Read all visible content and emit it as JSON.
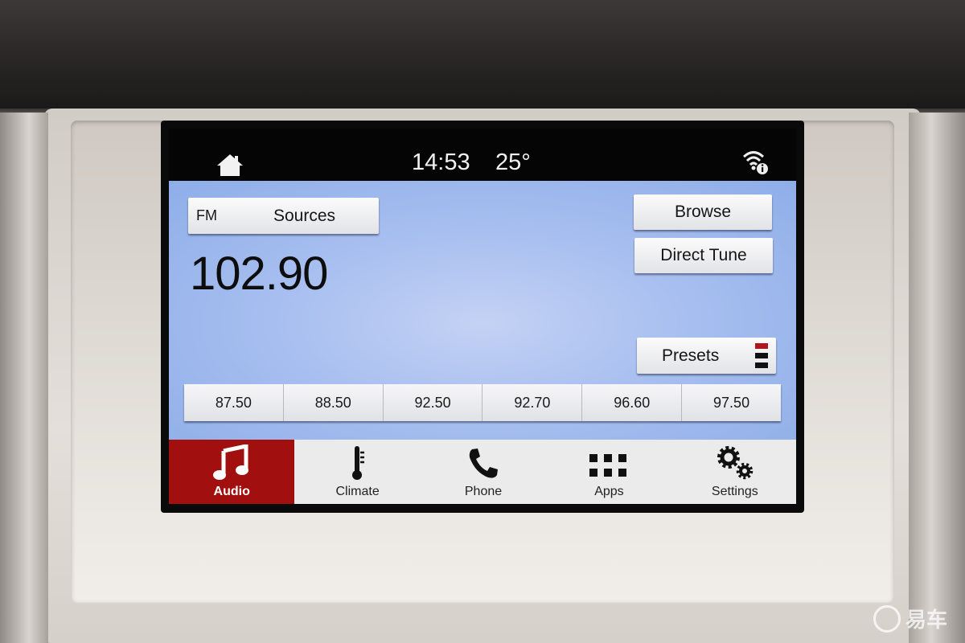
{
  "status_bar": {
    "time": "14:53",
    "temperature": "25°",
    "home_icon": "home-icon",
    "connectivity_icon": "wifi-info-icon"
  },
  "audio": {
    "band": "FM",
    "sources_label": "Sources",
    "frequency": "102.90",
    "browse_label": "Browse",
    "direct_tune_label": "Direct Tune",
    "presets_label": "Presets",
    "presets": [
      "87.50",
      "88.50",
      "92.50",
      "92.70",
      "96.60",
      "97.50"
    ]
  },
  "nav": {
    "tabs": [
      {
        "label": "Audio",
        "icon": "music-note-icon",
        "active": true
      },
      {
        "label": "Climate",
        "icon": "thermometer-icon"
      },
      {
        "label": "Phone",
        "icon": "phone-icon"
      },
      {
        "label": "Apps",
        "icon": "grid-icon"
      },
      {
        "label": "Settings",
        "icon": "gears-icon"
      }
    ]
  },
  "colors": {
    "active_tab": "#a1100f",
    "screen_background": "#a8bff0",
    "status_bar": "#050505"
  },
  "watermark": {
    "text": "易车"
  }
}
